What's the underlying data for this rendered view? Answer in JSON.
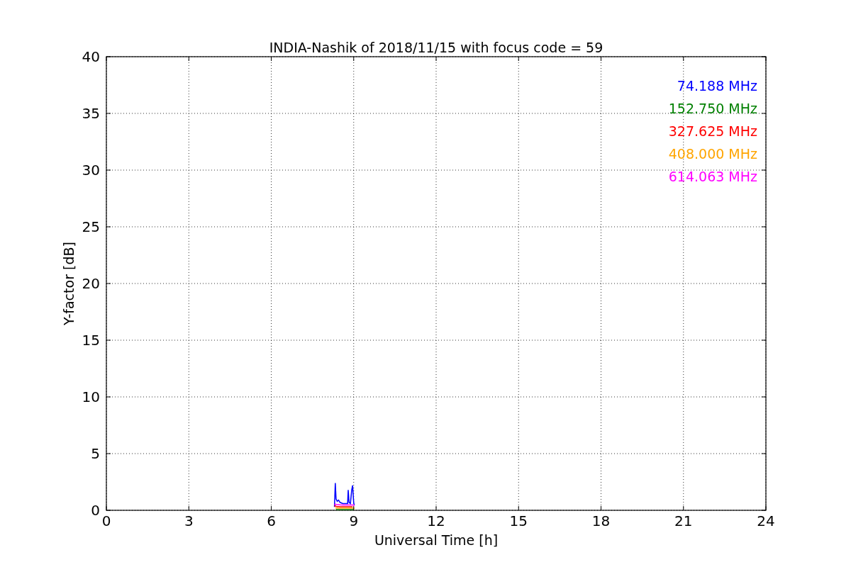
{
  "chart_data": {
    "type": "line",
    "title": "INDIA-Nashik of 2018/11/15 with focus code = 59",
    "xlabel": "Universal Time [h]",
    "ylabel": "Y-factor [dB]",
    "x": [
      8.3,
      8.33,
      8.36,
      8.4,
      8.45,
      8.5,
      8.6,
      8.7,
      8.78,
      8.8,
      8.83,
      8.88,
      8.93,
      8.96,
      9.0,
      9.03
    ],
    "series": [
      {
        "name": "74.188 MHz",
        "color": "#0000ff",
        "values": [
          0.3,
          2.4,
          1.0,
          0.8,
          0.9,
          0.7,
          0.6,
          0.6,
          0.6,
          1.8,
          0.7,
          0.6,
          1.8,
          2.2,
          0.6,
          0.5
        ]
      },
      {
        "name": "152.750 MHz",
        "color": "#008000",
        "values": [
          null,
          null,
          0.08,
          0.06,
          0.06,
          0.06,
          0.06,
          0.06,
          0.06,
          0.06,
          0.06,
          0.06,
          0.06,
          0.06,
          0.06,
          null
        ]
      },
      {
        "name": "327.625 MHz",
        "color": "#ff0000",
        "values": [
          0.35,
          0.4,
          0.35,
          0.33,
          0.33,
          0.32,
          0.32,
          0.32,
          0.32,
          0.32,
          0.32,
          0.32,
          0.32,
          0.32,
          null,
          null
        ]
      },
      {
        "name": "408.000 MHz",
        "color": "#ffa500",
        "values": [
          null,
          0.22,
          0.2,
          0.2,
          0.19,
          0.19,
          0.19,
          0.19,
          0.19,
          0.19,
          0.19,
          0.19,
          0.19,
          0.19,
          0.19,
          0.17
        ]
      },
      {
        "name": "614.063 MHz",
        "color": "#ff00ff",
        "values": [
          0.48,
          0.55,
          0.52,
          0.5,
          0.5,
          0.48,
          0.47,
          0.46,
          0.46,
          0.46,
          0.46,
          0.46,
          0.46,
          0.46,
          0.45,
          0.4
        ]
      }
    ],
    "xlim": [
      0,
      24
    ],
    "ylim": [
      0,
      40
    ],
    "grid": true,
    "xticks": [
      0,
      3,
      6,
      9,
      12,
      15,
      18,
      21,
      24
    ],
    "yticks": [
      0,
      5,
      10,
      15,
      20,
      25,
      30,
      35,
      40
    ]
  }
}
